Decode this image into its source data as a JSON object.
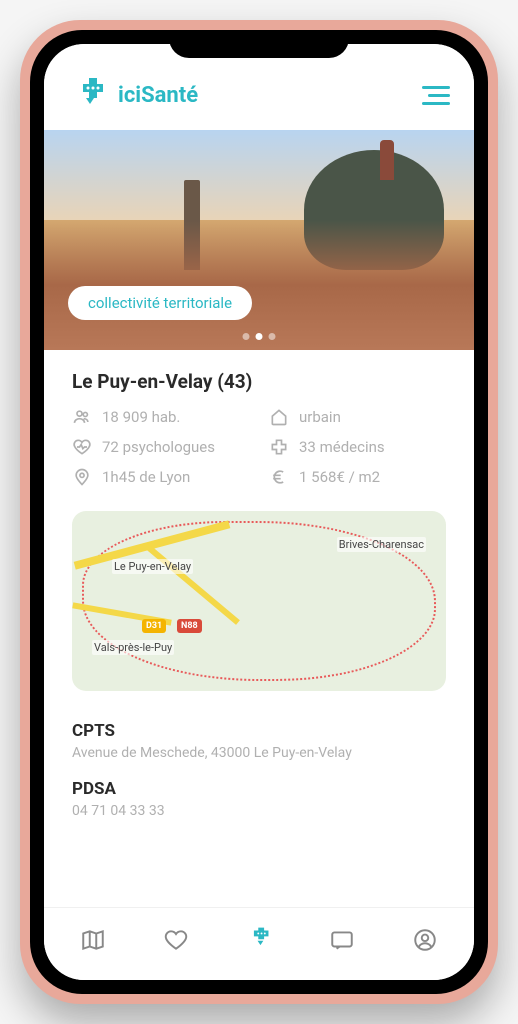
{
  "brand": {
    "name": "iciSanté"
  },
  "hero": {
    "badge": "collectivité territoriale"
  },
  "location": {
    "title": "Le Puy-en-Velay (43)",
    "stats": {
      "population": "18 909 hab.",
      "type": "urbain",
      "psych": "72 psychologues",
      "doctors": "33 médecins",
      "distance": "1h45 de Lyon",
      "price": "1 568€ / m2"
    }
  },
  "map": {
    "labels": {
      "main": "Le Puy-en-Velay",
      "ne": "Brives-Charensac",
      "sw": "Vals-près-le-Puy",
      "route1": "D31",
      "route2": "N88"
    }
  },
  "sections": {
    "cpts": {
      "title": "CPTS",
      "text": "Avenue de Meschede, 43000 Le Puy-en-Velay"
    },
    "pdsa": {
      "title": "PDSA",
      "text": "04 71 04 33 33"
    }
  }
}
